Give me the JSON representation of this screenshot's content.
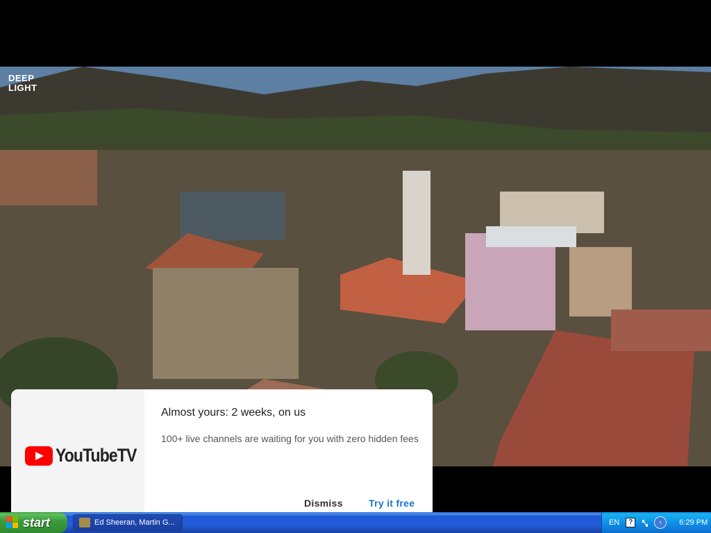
{
  "video": {
    "brand_line1": "DEEP",
    "brand_line2": "LIGHT"
  },
  "promo": {
    "logo_text": "YouTubeTV",
    "title": "Almost yours: 2 weeks, on us",
    "body": "100+ live channels are waiting for you with zero hidden fees",
    "dismiss_label": "Dismiss",
    "try_label": "Try it free",
    "try_color": "#1a73c8"
  },
  "taskbar": {
    "start_label": "start",
    "window_label": "Ed Sheeran, Martin G...",
    "language": "EN",
    "help_glyph": "?",
    "clock": "6:29 PM",
    "icons": [
      "start-flag-icon",
      "media-player-icon",
      "help-icon",
      "network-icon",
      "back-arrow-icon"
    ]
  }
}
